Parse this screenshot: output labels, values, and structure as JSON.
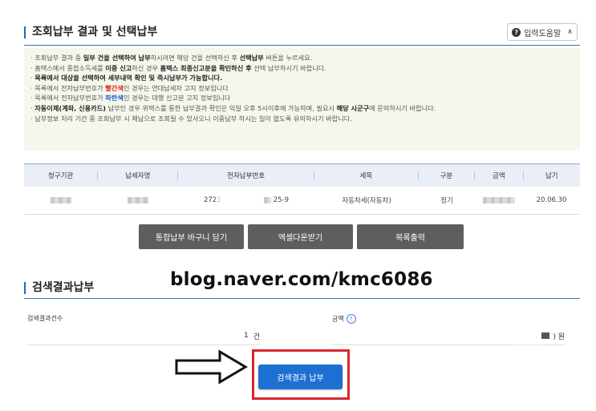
{
  "section1": {
    "title": "조회납부 결과 및 선택납부",
    "help_label": "입력도움말"
  },
  "notice": {
    "lines": [
      {
        "p1": "· 조회납부 결과 중 ",
        "b1": "일부 건을 선택하여 납부",
        "p2": "하시려면 해당 건을 선택하신 후 ",
        "b2": "선택납부",
        "p3": " 버튼을 누르세요."
      },
      {
        "p1": "· 홈택스에서 종합소득세를 ",
        "b1": "이중 신고",
        "p2": "하신 경우 ",
        "b2": "홈택스 최종신고분을 확인하신 후",
        "p3": " 선택 납부하시기 바랍니다."
      },
      {
        "p1": "· ",
        "b1": "목록에서 대상을 선택하여 세부내역 확인 및 즉시납부가 가능합니다.",
        "p2": "",
        "b2": "",
        "p3": ""
      },
      {
        "p1": "· 목록에서 전자납부번호가 ",
        "r1": "빨간색",
        "p2": "인 경우는 연대납세자 고지 정보입니다"
      },
      {
        "p1": "· 목록에서 전자납부번호가 ",
        "r1": "파란색",
        "p2": "인 경우는 대행 신고분 고지 정보입니다"
      },
      {
        "p1": "· ",
        "b1": "자동이체(계좌, 신용카드)",
        "p2": " 납부인 경우 위택스를 통한 납부결과 확인은 익일 오후 5시이후에 가능하며, 필요시 ",
        "b2": "해당 시군구",
        "p3": "에 문의하시기 바랍니다."
      },
      {
        "p1": "· 납부정보 처리 기간 중 조회납부 시 체납으로 조회될 수 있사오니 이중납부 하시는 일이 없도록 유의하시기 바랍니다.",
        "b1": "",
        "p2": "",
        "b2": "",
        "p3": ""
      }
    ]
  },
  "table": {
    "headers": [
      "청구기관",
      "납세자명",
      "전자납부번호",
      "세목",
      "구분",
      "금액",
      "납기"
    ],
    "row": {
      "epay_prefix": "2723",
      "epay_suffix": "25-9",
      "tax_item": "자동차세(자동차)",
      "type": "정기",
      "due": "20.06.30"
    }
  },
  "buttons": {
    "bulk_pay": "통합납부 바구니 담기",
    "excel": "엑셀다운받기",
    "print": "목록출력"
  },
  "watermark": "blog.naver.com/kmc6086",
  "section2": {
    "title": "검색결과납부",
    "count_label": "검색결과건수",
    "count_value": "1",
    "count_unit": "건",
    "amount_label": "금액",
    "amount_suffix": ") 원",
    "pay_button": "검색결과 납부"
  },
  "colors": {
    "accent": "#2b66b8",
    "pay_button": "#1e6fd2",
    "highlight": "#d9262c",
    "notice_bg": "#f4f8ec"
  }
}
